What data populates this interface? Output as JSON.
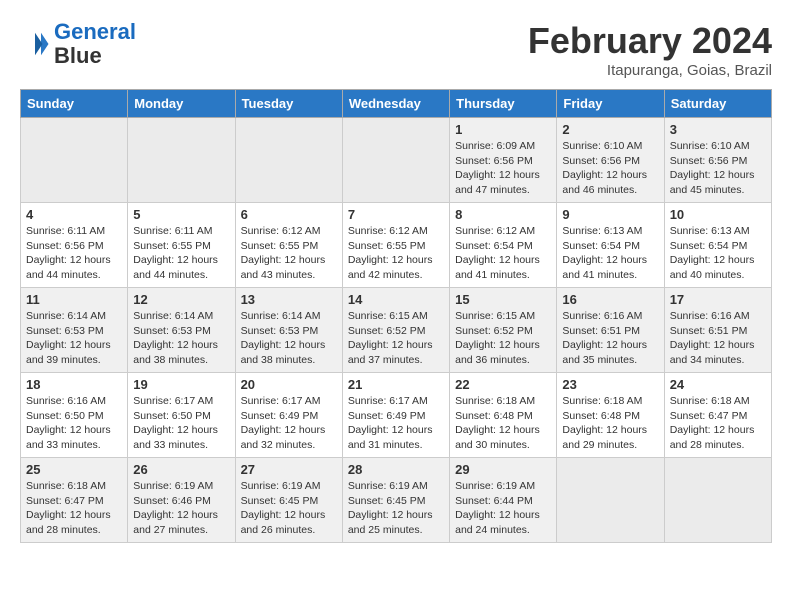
{
  "header": {
    "logo_line1": "General",
    "logo_line2": "Blue",
    "month_year": "February 2024",
    "location": "Itapuranga, Goias, Brazil"
  },
  "weekdays": [
    "Sunday",
    "Monday",
    "Tuesday",
    "Wednesday",
    "Thursday",
    "Friday",
    "Saturday"
  ],
  "weeks": [
    [
      {
        "day": "",
        "empty": true
      },
      {
        "day": "",
        "empty": true
      },
      {
        "day": "",
        "empty": true
      },
      {
        "day": "",
        "empty": true
      },
      {
        "day": "1",
        "sunrise": "6:09 AM",
        "sunset": "6:56 PM",
        "daylight": "12 hours and 47 minutes."
      },
      {
        "day": "2",
        "sunrise": "6:10 AM",
        "sunset": "6:56 PM",
        "daylight": "12 hours and 46 minutes."
      },
      {
        "day": "3",
        "sunrise": "6:10 AM",
        "sunset": "6:56 PM",
        "daylight": "12 hours and 45 minutes."
      }
    ],
    [
      {
        "day": "4",
        "sunrise": "6:11 AM",
        "sunset": "6:56 PM",
        "daylight": "12 hours and 44 minutes."
      },
      {
        "day": "5",
        "sunrise": "6:11 AM",
        "sunset": "6:55 PM",
        "daylight": "12 hours and 44 minutes."
      },
      {
        "day": "6",
        "sunrise": "6:12 AM",
        "sunset": "6:55 PM",
        "daylight": "12 hours and 43 minutes."
      },
      {
        "day": "7",
        "sunrise": "6:12 AM",
        "sunset": "6:55 PM",
        "daylight": "12 hours and 42 minutes."
      },
      {
        "day": "8",
        "sunrise": "6:12 AM",
        "sunset": "6:54 PM",
        "daylight": "12 hours and 41 minutes."
      },
      {
        "day": "9",
        "sunrise": "6:13 AM",
        "sunset": "6:54 PM",
        "daylight": "12 hours and 41 minutes."
      },
      {
        "day": "10",
        "sunrise": "6:13 AM",
        "sunset": "6:54 PM",
        "daylight": "12 hours and 40 minutes."
      }
    ],
    [
      {
        "day": "11",
        "sunrise": "6:14 AM",
        "sunset": "6:53 PM",
        "daylight": "12 hours and 39 minutes."
      },
      {
        "day": "12",
        "sunrise": "6:14 AM",
        "sunset": "6:53 PM",
        "daylight": "12 hours and 38 minutes."
      },
      {
        "day": "13",
        "sunrise": "6:14 AM",
        "sunset": "6:53 PM",
        "daylight": "12 hours and 38 minutes."
      },
      {
        "day": "14",
        "sunrise": "6:15 AM",
        "sunset": "6:52 PM",
        "daylight": "12 hours and 37 minutes."
      },
      {
        "day": "15",
        "sunrise": "6:15 AM",
        "sunset": "6:52 PM",
        "daylight": "12 hours and 36 minutes."
      },
      {
        "day": "16",
        "sunrise": "6:16 AM",
        "sunset": "6:51 PM",
        "daylight": "12 hours and 35 minutes."
      },
      {
        "day": "17",
        "sunrise": "6:16 AM",
        "sunset": "6:51 PM",
        "daylight": "12 hours and 34 minutes."
      }
    ],
    [
      {
        "day": "18",
        "sunrise": "6:16 AM",
        "sunset": "6:50 PM",
        "daylight": "12 hours and 33 minutes."
      },
      {
        "day": "19",
        "sunrise": "6:17 AM",
        "sunset": "6:50 PM",
        "daylight": "12 hours and 33 minutes."
      },
      {
        "day": "20",
        "sunrise": "6:17 AM",
        "sunset": "6:49 PM",
        "daylight": "12 hours and 32 minutes."
      },
      {
        "day": "21",
        "sunrise": "6:17 AM",
        "sunset": "6:49 PM",
        "daylight": "12 hours and 31 minutes."
      },
      {
        "day": "22",
        "sunrise": "6:18 AM",
        "sunset": "6:48 PM",
        "daylight": "12 hours and 30 minutes."
      },
      {
        "day": "23",
        "sunrise": "6:18 AM",
        "sunset": "6:48 PM",
        "daylight": "12 hours and 29 minutes."
      },
      {
        "day": "24",
        "sunrise": "6:18 AM",
        "sunset": "6:47 PM",
        "daylight": "12 hours and 28 minutes."
      }
    ],
    [
      {
        "day": "25",
        "sunrise": "6:18 AM",
        "sunset": "6:47 PM",
        "daylight": "12 hours and 28 minutes."
      },
      {
        "day": "26",
        "sunrise": "6:19 AM",
        "sunset": "6:46 PM",
        "daylight": "12 hours and 27 minutes."
      },
      {
        "day": "27",
        "sunrise": "6:19 AM",
        "sunset": "6:45 PM",
        "daylight": "12 hours and 26 minutes."
      },
      {
        "day": "28",
        "sunrise": "6:19 AM",
        "sunset": "6:45 PM",
        "daylight": "12 hours and 25 minutes."
      },
      {
        "day": "29",
        "sunrise": "6:19 AM",
        "sunset": "6:44 PM",
        "daylight": "12 hours and 24 minutes."
      },
      {
        "day": "",
        "empty": true
      },
      {
        "day": "",
        "empty": true
      }
    ]
  ]
}
